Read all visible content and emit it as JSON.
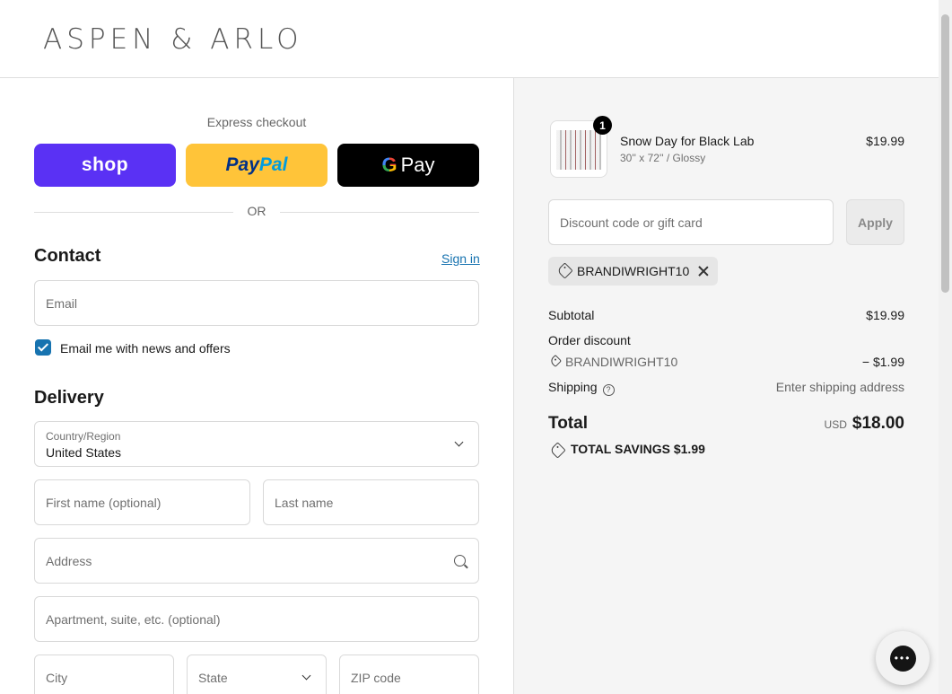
{
  "header": {
    "logo": "ASPEN & ARLO"
  },
  "express": {
    "label": "Express checkout",
    "shop": "shop",
    "paypal_a": "Pay",
    "paypal_b": "Pal",
    "gpay_g": "G",
    "gpay_text": "Pay",
    "or": "OR"
  },
  "contact": {
    "title": "Contact",
    "signin": "Sign in",
    "email_placeholder": "Email",
    "newsletter": "Email me with news and offers"
  },
  "delivery": {
    "title": "Delivery",
    "country_label": "Country/Region",
    "country_value": "United States",
    "first_name": "First name (optional)",
    "last_name": "Last name",
    "address": "Address",
    "apartment": "Apartment, suite, etc. (optional)",
    "city": "City",
    "state": "State",
    "zip": "ZIP code"
  },
  "cart": {
    "item": {
      "qty": "1",
      "name": "Snow Day for Black Lab",
      "variant": "30'' x 72'' / Glossy",
      "price": "$19.99"
    },
    "discount_placeholder": "Discount code or gift card",
    "apply": "Apply",
    "applied_code": "BRANDIWRIGHT10",
    "subtotal_label": "Subtotal",
    "subtotal_value": "$19.99",
    "order_discount_label": "Order discount",
    "discount_code": "BRANDIWRIGHT10",
    "discount_value": "− $1.99",
    "shipping_label": "Shipping",
    "shipping_value": "Enter shipping address",
    "total_label": "Total",
    "currency": "USD",
    "total_value": "$18.00",
    "savings": "TOTAL SAVINGS  $1.99"
  }
}
